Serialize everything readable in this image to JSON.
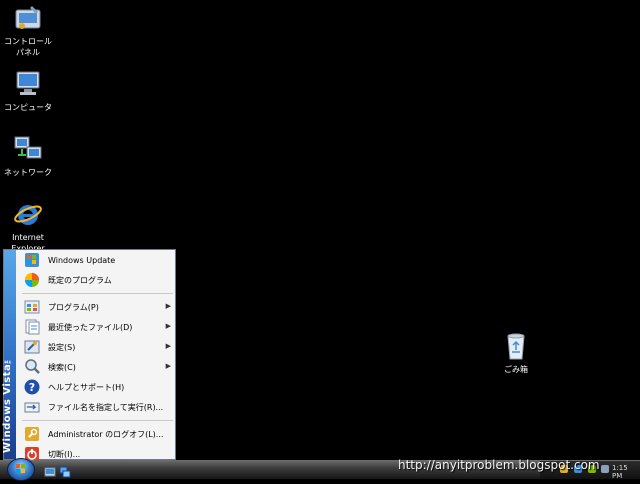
{
  "desktop": {
    "icons": [
      {
        "label": "コントロール\nパネル",
        "icon": "control-panel-icon"
      },
      {
        "label": "コンピュータ",
        "icon": "computer-icon"
      },
      {
        "label": "ネットワーク",
        "icon": "network-icon"
      },
      {
        "label": "Internet\nExplorer",
        "icon": "internet-explorer-icon"
      },
      {
        "label": "ごみ箱",
        "icon": "recycle-bin-icon"
      }
    ]
  },
  "start_menu": {
    "brand": "Windows Vista™",
    "pinned": [
      {
        "label": "Windows Update",
        "icon": "windows-update-icon"
      },
      {
        "label": "既定のプログラム",
        "icon": "default-programs-icon"
      }
    ],
    "items": [
      {
        "label": "プログラム(P)",
        "icon": "programs-icon",
        "submenu": true
      },
      {
        "label": "最近使ったファイル(D)",
        "icon": "recent-documents-icon",
        "submenu": true
      },
      {
        "label": "設定(S)",
        "icon": "settings-icon",
        "submenu": true
      },
      {
        "label": "検索(C)",
        "icon": "search-icon",
        "submenu": true
      },
      {
        "label": "ヘルプとサポート(H)",
        "icon": "help-icon",
        "submenu": false
      },
      {
        "label": "ファイル名を指定して実行(R)...",
        "icon": "run-icon",
        "submenu": false
      }
    ],
    "session": [
      {
        "label": "Administrator のログオフ(L)...",
        "icon": "logoff-icon"
      },
      {
        "label": "切断(I)...",
        "icon": "shutdown-icon"
      }
    ]
  },
  "taskbar": {
    "watermark": "http://anyitproblem.blogspot.com",
    "clock": "1:15 PM"
  },
  "colors": {
    "desktop_background": "#000000",
    "menu_stripe": "#2f6ec2",
    "menu_background": "#f4f4f4"
  }
}
